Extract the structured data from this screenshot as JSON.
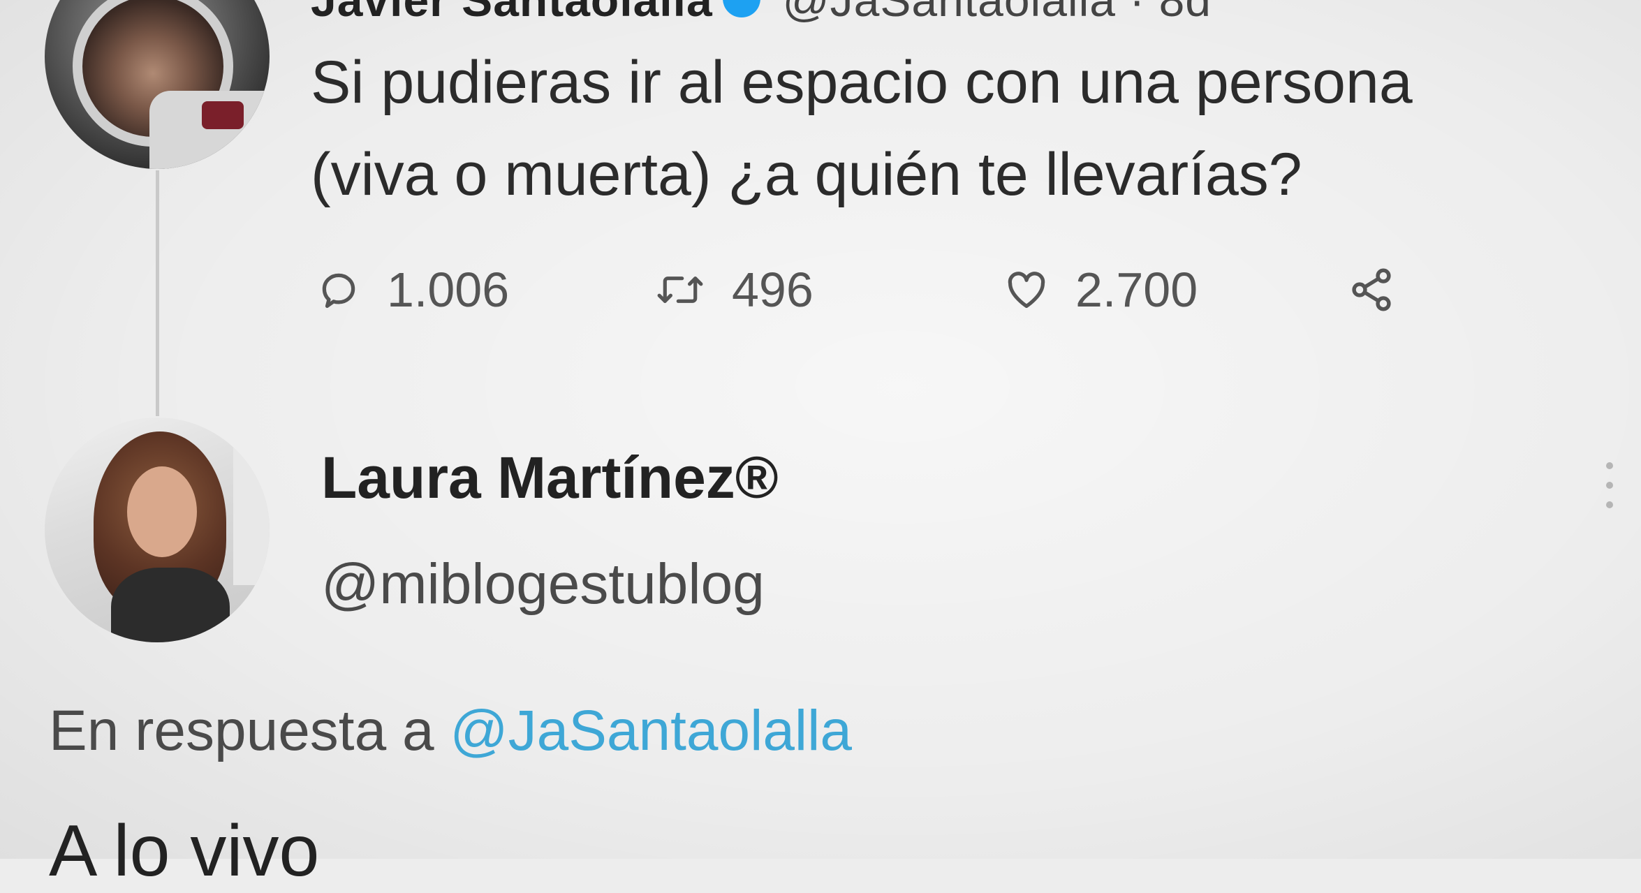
{
  "original_tweet": {
    "author_name_partial": "Javier Santaolalla",
    "author_handle_partial": "@JaSantaolalla · 8d",
    "text_line1": "Si pudieras ir al espacio con una persona",
    "text_line2": "(viva o muerta) ¿a quién te llevarías?",
    "reply_count": "1.006",
    "retweet_count": "496",
    "like_count": "2.700"
  },
  "reply_tweet": {
    "author_name": "Laura Martínez®",
    "author_handle": "@miblogestublog",
    "replying_to_prefix": "En respuesta a",
    "replying_to_handle": "@JaSantaolalla",
    "text": "A lo vivo"
  },
  "icons": {
    "reply": "speech-bubble-icon",
    "retweet": "retweet-arrows-icon",
    "like": "heart-icon",
    "share": "share-nodes-icon",
    "more": "vertical-ellipsis-icon",
    "verified": "verified-badge-icon"
  },
  "colors": {
    "background": "#ededed",
    "mention": "#3ea7d6",
    "verified": "#1da1f2",
    "icon_gray": "#555555"
  }
}
